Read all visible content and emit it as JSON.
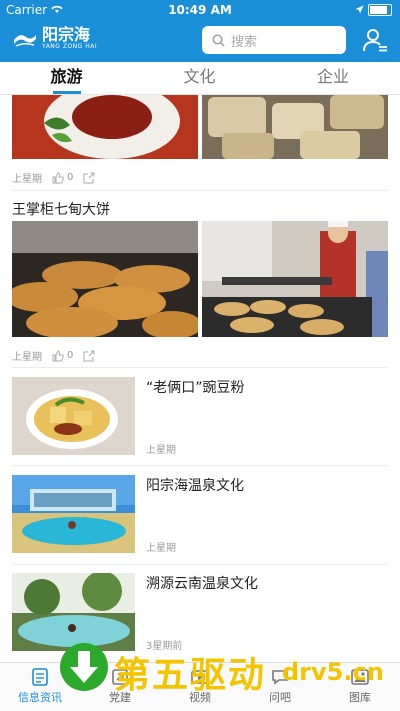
{
  "status_bar": {
    "carrier": "Carrier",
    "time": "10:49 AM"
  },
  "header": {
    "logo_name": "阳宗海",
    "logo_subtitle": "YANG ZONG HAI",
    "search_placeholder": "搜索"
  },
  "tabs": [
    {
      "label": "旅游",
      "active": true
    },
    {
      "label": "文化",
      "active": false
    },
    {
      "label": "企业",
      "active": false
    }
  ],
  "feed": {
    "items": [
      {
        "title": "",
        "date": "上星期",
        "likes": "0"
      },
      {
        "title": "王掌柜七甸大饼",
        "date": "上星期",
        "likes": "0"
      },
      {
        "title": "“老俩口”豌豆粉",
        "date": "上星期"
      },
      {
        "title": "阳宗海温泉文化",
        "date": "上星期"
      },
      {
        "title": "溯源云南温泉文化",
        "date": "3星期前"
      }
    ]
  },
  "tabbar": [
    {
      "label": "信息资讯",
      "icon": "news-icon",
      "active": true
    },
    {
      "label": "党建",
      "icon": "party-icon",
      "active": false
    },
    {
      "label": "视频",
      "icon": "video-icon",
      "active": false
    },
    {
      "label": "问吧",
      "icon": "chat-icon",
      "active": false
    },
    {
      "label": "图库",
      "icon": "gallery-icon",
      "active": false
    }
  ],
  "watermark": {
    "text_cn": "第五驱动",
    "text_url": "drv5.cn"
  },
  "colors": {
    "brand": "#1a8fd8",
    "watermark_text": "#f5c400",
    "watermark_arrow": "#2aa92a"
  }
}
